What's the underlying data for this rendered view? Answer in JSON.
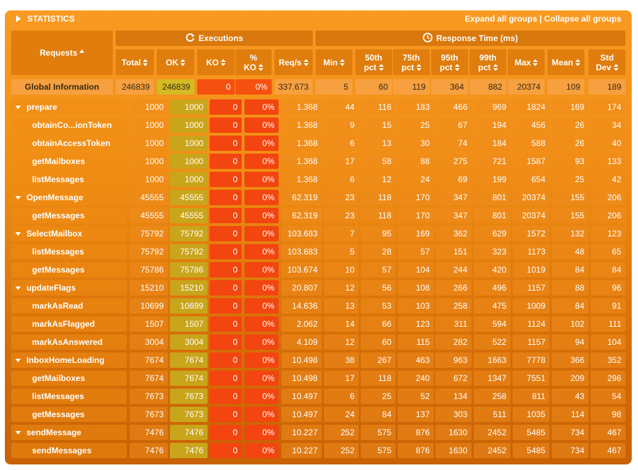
{
  "header": {
    "title": "STATISTICS",
    "expand_label": "Expand all groups",
    "separator": "|",
    "collapse_label": "Collapse all groups"
  },
  "columns": {
    "requests": "Requests",
    "executions": "Executions",
    "response_time": "Response Time (ms)",
    "total": "Total",
    "ok": "OK",
    "ko": "KO",
    "pct_ko_line1": "%",
    "pct_ko_line2": "KO",
    "reqs": "Req/s",
    "min": "Min",
    "p50_line1": "50th",
    "p50_line2": "pct",
    "p75_line1": "75th",
    "p75_line2": "pct",
    "p95_line1": "95th",
    "p95_line2": "pct",
    "p99_line1": "99th",
    "p99_line2": "pct",
    "max": "Max",
    "mean": "Mean",
    "std_line1": "Std",
    "std_line2": "Dev"
  },
  "global": {
    "name": "Global Information",
    "total": "246839",
    "ok": "246839",
    "ko": "0",
    "pct_ko": "0%",
    "reqs": "337.673",
    "min": "5",
    "p50": "60",
    "p75": "119",
    "p95": "364",
    "p99": "882",
    "max": "20374",
    "mean": "109",
    "std": "189"
  },
  "rows": [
    {
      "kind": "group",
      "name": "prepare",
      "total": "1000",
      "ok": "1000",
      "ko": "0",
      "pct_ko": "0%",
      "reqs": "1.368",
      "min": "44",
      "p50": "116",
      "p75": "183",
      "p95": "466",
      "p99": "969",
      "max": "1824",
      "mean": "169",
      "std": "174"
    },
    {
      "kind": "child",
      "name": "obtainCo...ionToken",
      "total": "1000",
      "ok": "1000",
      "ko": "0",
      "pct_ko": "0%",
      "reqs": "1.368",
      "min": "9",
      "p50": "15",
      "p75": "25",
      "p95": "67",
      "p99": "194",
      "max": "456",
      "mean": "26",
      "std": "34"
    },
    {
      "kind": "child",
      "name": "obtainAccessToken",
      "total": "1000",
      "ok": "1000",
      "ko": "0",
      "pct_ko": "0%",
      "reqs": "1.368",
      "min": "6",
      "p50": "13",
      "p75": "30",
      "p95": "74",
      "p99": "184",
      "max": "588",
      "mean": "26",
      "std": "40"
    },
    {
      "kind": "child",
      "name": "getMailboxes",
      "total": "1000",
      "ok": "1000",
      "ko": "0",
      "pct_ko": "0%",
      "reqs": "1.368",
      "min": "17",
      "p50": "58",
      "p75": "88",
      "p95": "275",
      "p99": "721",
      "max": "1587",
      "mean": "93",
      "std": "133"
    },
    {
      "kind": "child",
      "name": "listMessages",
      "total": "1000",
      "ok": "1000",
      "ko": "0",
      "pct_ko": "0%",
      "reqs": "1.368",
      "min": "6",
      "p50": "12",
      "p75": "24",
      "p95": "69",
      "p99": "199",
      "max": "654",
      "mean": "25",
      "std": "42"
    },
    {
      "kind": "group",
      "name": "OpenMessage",
      "total": "45555",
      "ok": "45555",
      "ko": "0",
      "pct_ko": "0%",
      "reqs": "62.319",
      "min": "23",
      "p50": "118",
      "p75": "170",
      "p95": "347",
      "p99": "801",
      "max": "20374",
      "mean": "155",
      "std": "206"
    },
    {
      "kind": "child",
      "name": "getMessages",
      "total": "45555",
      "ok": "45555",
      "ko": "0",
      "pct_ko": "0%",
      "reqs": "62.319",
      "min": "23",
      "p50": "118",
      "p75": "170",
      "p95": "347",
      "p99": "801",
      "max": "20374",
      "mean": "155",
      "std": "206"
    },
    {
      "kind": "group",
      "name": "SelectMailbox",
      "total": "75792",
      "ok": "75792",
      "ko": "0",
      "pct_ko": "0%",
      "reqs": "103.683",
      "min": "7",
      "p50": "95",
      "p75": "169",
      "p95": "362",
      "p99": "629",
      "max": "1572",
      "mean": "132",
      "std": "123"
    },
    {
      "kind": "child",
      "name": "listMessages",
      "total": "75792",
      "ok": "75792",
      "ko": "0",
      "pct_ko": "0%",
      "reqs": "103.683",
      "min": "5",
      "p50": "28",
      "p75": "57",
      "p95": "151",
      "p99": "323",
      "max": "1173",
      "mean": "48",
      "std": "65"
    },
    {
      "kind": "child",
      "name": "getMessages",
      "total": "75786",
      "ok": "75786",
      "ko": "0",
      "pct_ko": "0%",
      "reqs": "103.674",
      "min": "10",
      "p50": "57",
      "p75": "104",
      "p95": "244",
      "p99": "420",
      "max": "1019",
      "mean": "84",
      "std": "84"
    },
    {
      "kind": "group",
      "name": "updateFlags",
      "total": "15210",
      "ok": "15210",
      "ko": "0",
      "pct_ko": "0%",
      "reqs": "20.807",
      "min": "12",
      "p50": "56",
      "p75": "108",
      "p95": "266",
      "p99": "496",
      "max": "1157",
      "mean": "88",
      "std": "96"
    },
    {
      "kind": "child",
      "name": "markAsRead",
      "total": "10699",
      "ok": "10699",
      "ko": "0",
      "pct_ko": "0%",
      "reqs": "14.636",
      "min": "13",
      "p50": "53",
      "p75": "103",
      "p95": "258",
      "p99": "475",
      "max": "1009",
      "mean": "84",
      "std": "91"
    },
    {
      "kind": "child",
      "name": "markAsFlagged",
      "total": "1507",
      "ok": "1507",
      "ko": "0",
      "pct_ko": "0%",
      "reqs": "2.062",
      "min": "14",
      "p50": "66",
      "p75": "123",
      "p95": "311",
      "p99": "594",
      "max": "1124",
      "mean": "102",
      "std": "111"
    },
    {
      "kind": "child",
      "name": "markAsAnswered",
      "total": "3004",
      "ok": "3004",
      "ko": "0",
      "pct_ko": "0%",
      "reqs": "4.109",
      "min": "12",
      "p50": "60",
      "p75": "115",
      "p95": "282",
      "p99": "522",
      "max": "1157",
      "mean": "94",
      "std": "104"
    },
    {
      "kind": "group",
      "name": "InboxHomeLoading",
      "total": "7674",
      "ok": "7674",
      "ko": "0",
      "pct_ko": "0%",
      "reqs": "10.498",
      "min": "38",
      "p50": "267",
      "p75": "463",
      "p95": "963",
      "p99": "1663",
      "max": "7778",
      "mean": "366",
      "std": "352"
    },
    {
      "kind": "child",
      "name": "getMailboxes",
      "total": "7674",
      "ok": "7674",
      "ko": "0",
      "pct_ko": "0%",
      "reqs": "10.498",
      "min": "17",
      "p50": "118",
      "p75": "240",
      "p95": "672",
      "p99": "1347",
      "max": "7551",
      "mean": "209",
      "std": "296"
    },
    {
      "kind": "child",
      "name": "listMessages",
      "total": "7673",
      "ok": "7673",
      "ko": "0",
      "pct_ko": "0%",
      "reqs": "10.497",
      "min": "6",
      "p50": "25",
      "p75": "52",
      "p95": "134",
      "p99": "258",
      "max": "811",
      "mean": "43",
      "std": "54"
    },
    {
      "kind": "child",
      "name": "getMessages",
      "total": "7673",
      "ok": "7673",
      "ko": "0",
      "pct_ko": "0%",
      "reqs": "10.497",
      "min": "24",
      "p50": "84",
      "p75": "137",
      "p95": "303",
      "p99": "511",
      "max": "1035",
      "mean": "114",
      "std": "98"
    },
    {
      "kind": "group",
      "name": "sendMessage",
      "total": "7476",
      "ok": "7476",
      "ko": "0",
      "pct_ko": "0%",
      "reqs": "10.227",
      "min": "252",
      "p50": "575",
      "p75": "876",
      "p95": "1630",
      "p99": "2452",
      "max": "5485",
      "mean": "734",
      "std": "467"
    },
    {
      "kind": "child",
      "name": "sendMessages",
      "total": "7476",
      "ok": "7476",
      "ko": "0",
      "pct_ko": "0%",
      "reqs": "10.227",
      "min": "252",
      "p50": "575",
      "p75": "876",
      "p95": "1630",
      "p99": "2452",
      "max": "5485",
      "mean": "734",
      "std": "467"
    }
  ]
}
